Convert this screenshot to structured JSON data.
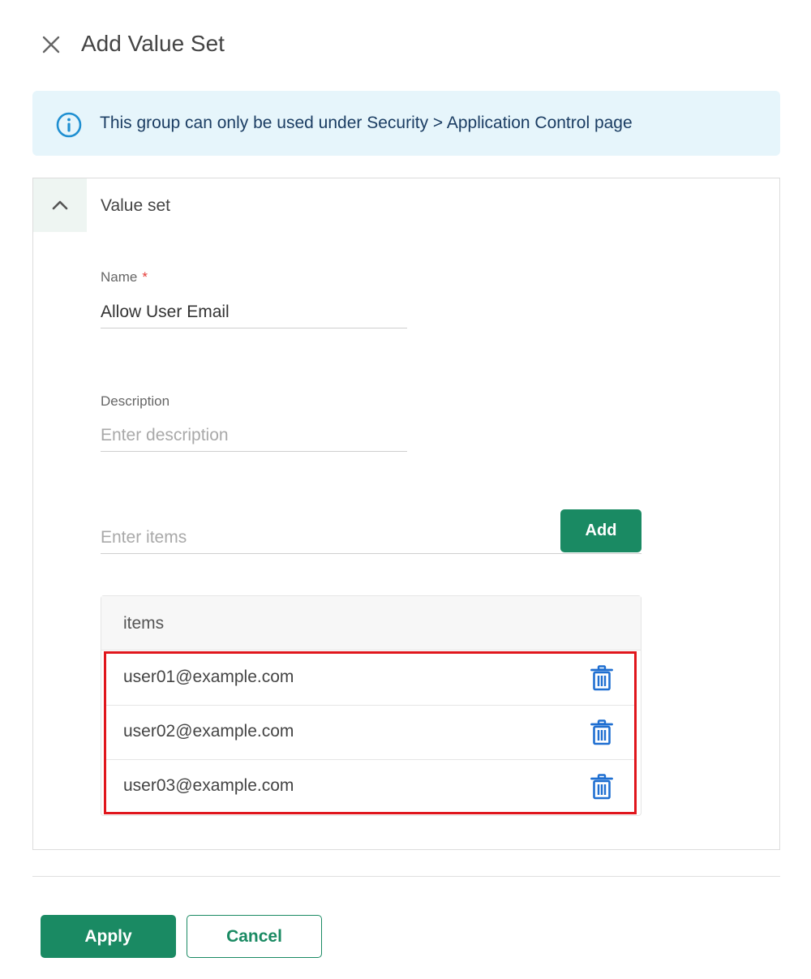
{
  "header": {
    "title": "Add Value Set",
    "close_icon": "close-icon"
  },
  "info_banner": {
    "icon": "info-icon",
    "text": "This group can only be used under Security > Application Control page",
    "color": "#1b3d63",
    "background": "#e6f5fb"
  },
  "value_set": {
    "title": "Value set",
    "toggle_icon": "chevron-up-icon",
    "name_field": {
      "label": "Name",
      "required_marker": "*",
      "value": "Allow User Email"
    },
    "description_field": {
      "label": "Description",
      "value": "",
      "placeholder": "Enter description"
    },
    "items_input": {
      "value": "",
      "placeholder": "Enter items"
    },
    "add_label": "Add",
    "items_table": {
      "header": "items",
      "rows": [
        {
          "value": "user01@example.com",
          "action_icon": "trash-icon"
        },
        {
          "value": "user02@example.com",
          "action_icon": "trash-icon"
        },
        {
          "value": "user03@example.com",
          "action_icon": "trash-icon"
        }
      ]
    }
  },
  "footer": {
    "apply_label": "Apply",
    "cancel_label": "Cancel"
  },
  "colors": {
    "primary": "#1a8a63",
    "highlight": "#e0161c",
    "icon_blue": "#1f6fd1"
  }
}
